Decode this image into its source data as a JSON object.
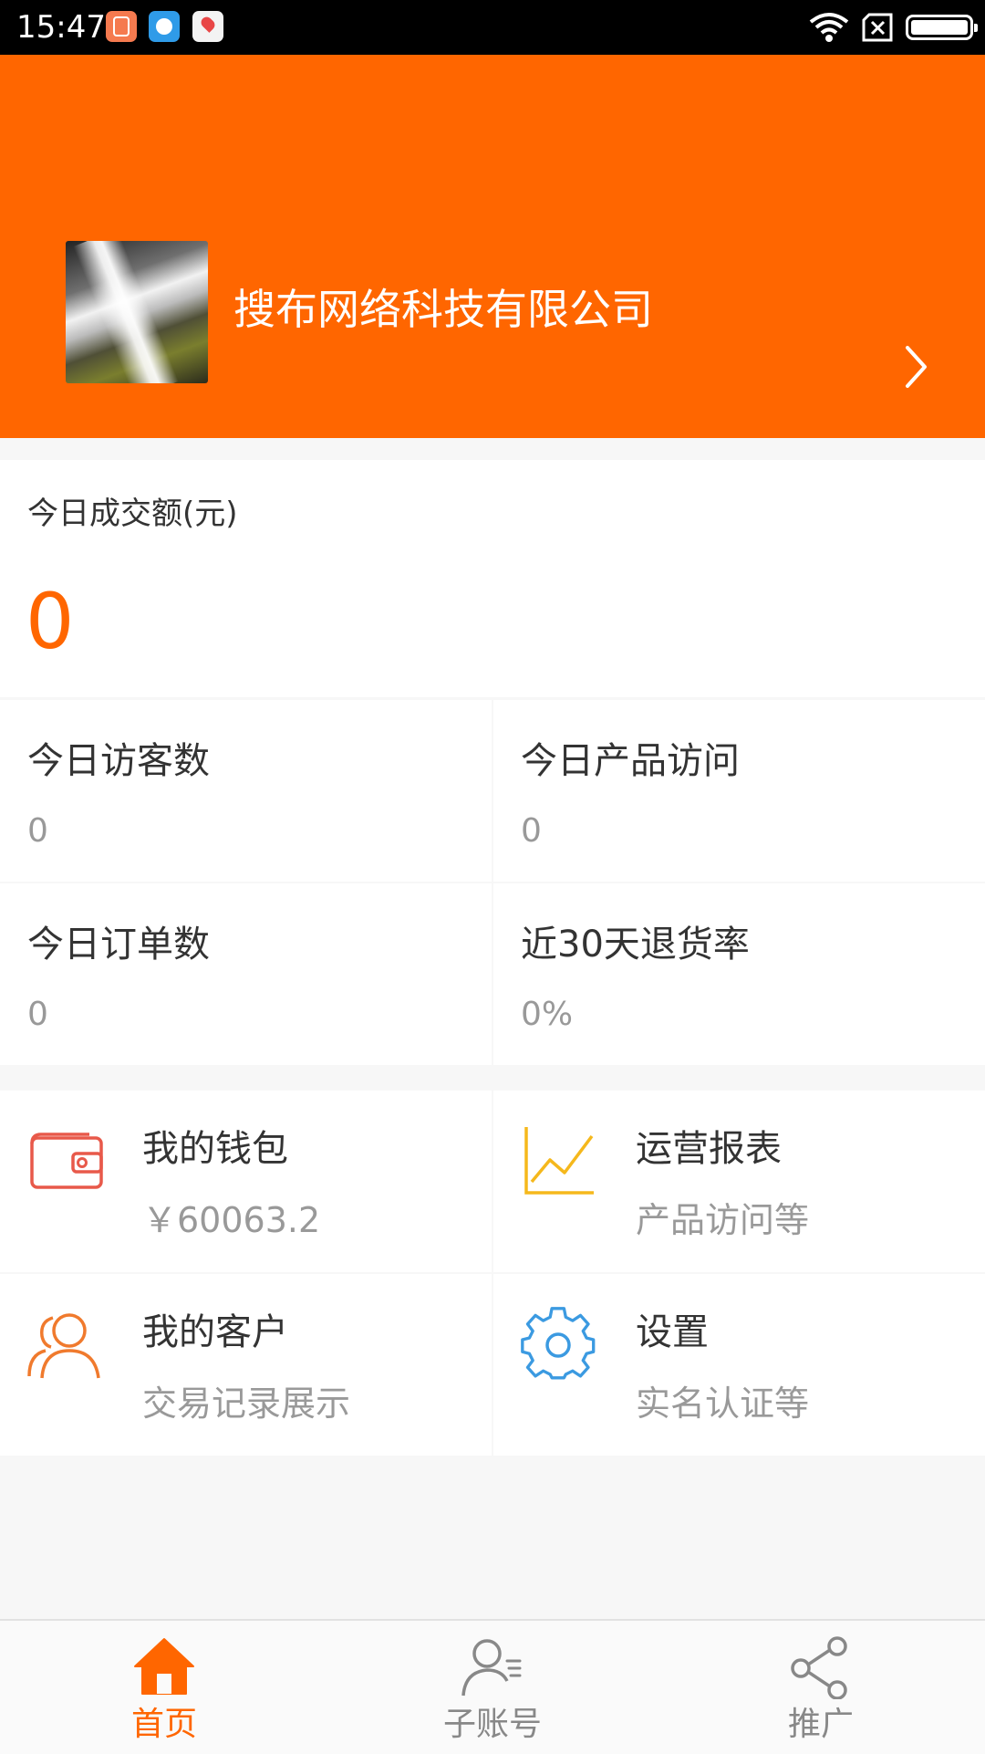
{
  "status_bar": {
    "time": "15:47",
    "icons": [
      "app-notification-icon",
      "app-notification-icon",
      "map-notification-icon",
      "wifi-icon",
      "no-sim-icon",
      "battery-icon"
    ]
  },
  "header": {
    "company_name": "搜布网络科技有限公司",
    "background_color": "#ff6600"
  },
  "sales": {
    "label": "今日成交额(元)",
    "value": "0"
  },
  "stats": [
    {
      "title": "今日访客数",
      "value": "0"
    },
    {
      "title": "今日产品访问",
      "value": "0"
    },
    {
      "title": "今日订单数",
      "value": "0"
    },
    {
      "title": "近30天退货率",
      "value": "0%"
    }
  ],
  "menu": [
    {
      "title": "我的钱包",
      "subtitle": "￥60063.2",
      "icon": "wallet-icon",
      "icon_color": "#e8594a"
    },
    {
      "title": "运营报表",
      "subtitle": "产品访问等",
      "icon": "line-chart-icon",
      "icon_color": "#f5b81c"
    },
    {
      "title": "我的客户",
      "subtitle": "交易记录展示",
      "icon": "customers-icon",
      "icon_color": "#f07a2d"
    },
    {
      "title": "设置",
      "subtitle": "实名认证等",
      "icon": "settings-gear-icon",
      "icon_color": "#3b9ae1"
    }
  ],
  "tabbar": {
    "tabs": [
      {
        "label": "首页",
        "icon": "home-icon",
        "active": true
      },
      {
        "label": "子账号",
        "icon": "sub-account-icon",
        "active": false
      },
      {
        "label": "推广",
        "icon": "share-icon",
        "active": false
      }
    ],
    "active_color": "#ff6600",
    "inactive_color": "#888888"
  }
}
